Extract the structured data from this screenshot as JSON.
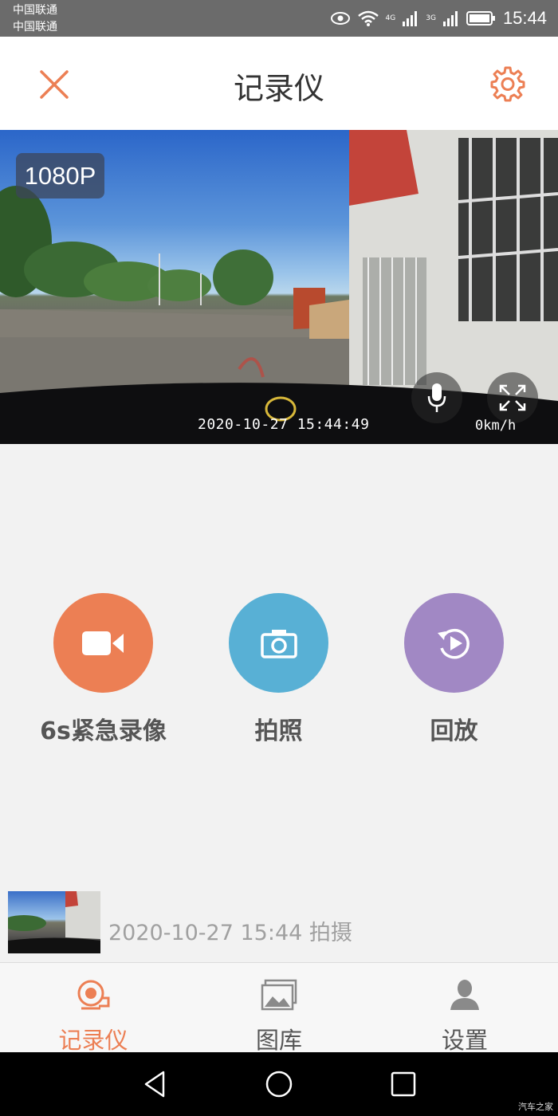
{
  "status_bar": {
    "carrier_1": "中国联通",
    "carrier_2": "中国联通",
    "net_1": "4G",
    "net_2": "3G",
    "time": "15:44"
  },
  "header": {
    "title": "记录仪",
    "close_icon": "close-icon",
    "settings_icon": "gear-icon"
  },
  "video": {
    "resolution": "1080P",
    "timestamp": "2020-10-27 15:44:49",
    "speed": "0km/h",
    "mic_icon": "microphone-icon",
    "fullscreen_icon": "fullscreen-icon"
  },
  "actions": [
    {
      "label": "6s紧急录像",
      "icon": "video-camera-icon",
      "color": "#ec7f54"
    },
    {
      "label": "拍照",
      "icon": "camera-icon",
      "color": "#58b0d5"
    },
    {
      "label": "回放",
      "icon": "replay-icon",
      "color": "#a188c4"
    }
  ],
  "latest": {
    "caption": "2020-10-27 15:44 拍摄"
  },
  "bottom_nav": [
    {
      "label": "记录仪",
      "icon": "dashcam-icon",
      "active": true
    },
    {
      "label": "图库",
      "icon": "gallery-icon",
      "active": false
    },
    {
      "label": "设置",
      "icon": "user-icon",
      "active": false
    }
  ],
  "system_nav": {
    "watermark": "汽车之家"
  },
  "colors": {
    "accent": "#ec7f54",
    "photo": "#58b0d5",
    "playback": "#a188c4"
  }
}
